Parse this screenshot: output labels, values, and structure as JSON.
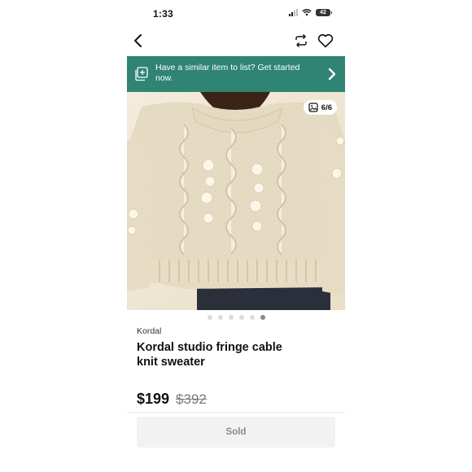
{
  "status_bar": {
    "time": "1:33",
    "battery": "42"
  },
  "banner": {
    "text": "Have a similar item to list? Get started now."
  },
  "gallery": {
    "counter": "6/6",
    "total": 6,
    "active_index": 5
  },
  "product": {
    "brand": "Kordal",
    "title": "Kordal studio fringe cable knit sweater",
    "price": "$199",
    "original_price": "$392",
    "status_button": "Sold"
  },
  "colors": {
    "banner_bg": "#2f8474",
    "sweater": "#efe6d2"
  },
  "icons": [
    "back-arrow-icon",
    "share-repost-icon",
    "heart-icon",
    "list-item-icon",
    "chevron-right-icon",
    "gallery-icon"
  ]
}
